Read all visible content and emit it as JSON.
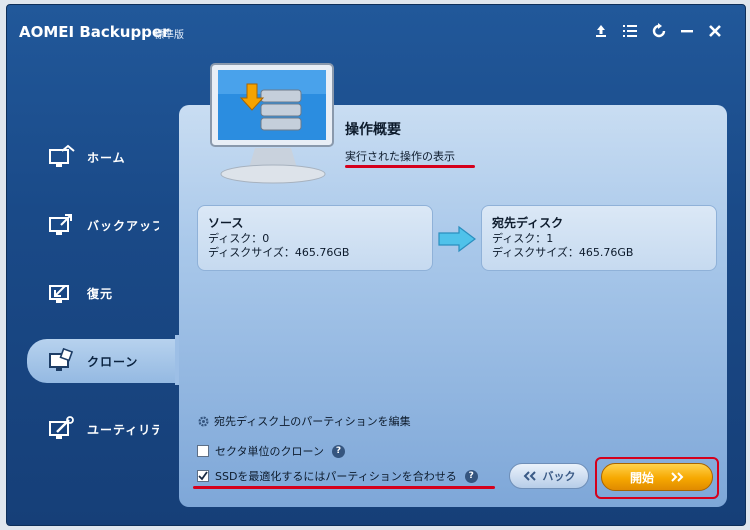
{
  "window": {
    "title": "AOMEI Backupper",
    "edition": "標準版"
  },
  "titlebar_icons": [
    "upload-icon",
    "menu-icon",
    "refresh-icon",
    "minimize-icon",
    "close-icon"
  ],
  "sidebar": {
    "items": [
      {
        "label": "ホーム",
        "icon": "home-icon"
      },
      {
        "label": "バックアップ",
        "icon": "backup-icon"
      },
      {
        "label": "復元",
        "icon": "restore-icon"
      },
      {
        "label": "クローン",
        "icon": "clone-icon",
        "active": true
      },
      {
        "label": "ユーティリティ",
        "icon": "utilities-icon"
      }
    ]
  },
  "summary": {
    "title": "操作概要",
    "subtitle": "実行された操作の表示"
  },
  "source": {
    "title": "ソース",
    "disk_line": "ディスク：0",
    "size_line": "ディスクサイズ：465.76GB"
  },
  "destination": {
    "title": "宛先ディスク",
    "disk_line": "ディスク：1",
    "size_line": "ディスクサイズ：465.76GB"
  },
  "options": {
    "edit_partitions": "宛先ディスク上のパーティションを編集",
    "sector_clone": "セクタ単位のクローン",
    "sector_clone_checked": false,
    "ssd_align": "SSDを最適化するにはパーティションを合わせる",
    "ssd_align_checked": true,
    "help": "?"
  },
  "buttons": {
    "back": "バック",
    "start": "開始"
  },
  "colors": {
    "window": "#1a4a88",
    "panel": "#a9c8ea",
    "start_button": "#f6a800",
    "highlight": "#d5001c"
  }
}
